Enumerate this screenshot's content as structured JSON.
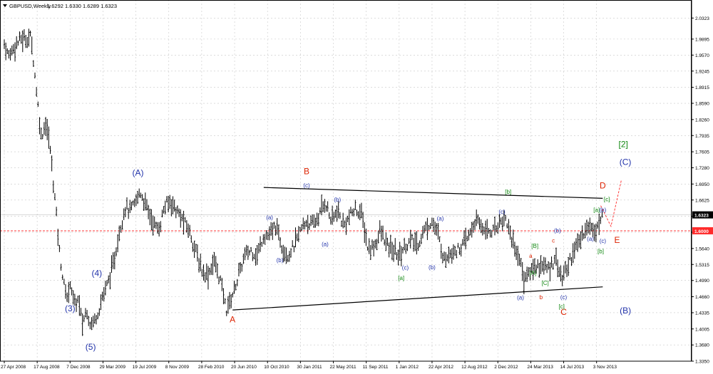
{
  "header": {
    "symbol": "GBPUSD,Weekly",
    "quote": "1.6292 1.6330 1.6289 1.6323"
  },
  "colors": {
    "background": "#ffffff",
    "grid": "#c8c8c8",
    "bars": "#000000",
    "wave_blue": "#2233aa",
    "wave_red": "#dd2200",
    "wave_green": "#118811",
    "level_line": "#ff3b3b",
    "price_label_current": "#000000",
    "price_label_level": "#ff2b2b"
  },
  "chart_data": {
    "type": "ohlc",
    "title": "GBPUSD,Weekly",
    "ylim": [
      1.335,
      2.04
    ],
    "price_ticks": [
      "2.0323",
      "1.9895",
      "1.9570",
      "1.9245",
      "1.8915",
      "1.8590",
      "1.8260",
      "1.7935",
      "1.7605",
      "1.7280",
      "1.6950",
      "1.6625",
      "1.6295",
      "1.5970",
      "1.5640",
      "1.5315",
      "1.4990",
      "1.4660",
      "1.4335",
      "1.4005",
      "1.3680",
      "1.3350"
    ],
    "x_ticks": [
      "27 Apr 2008",
      "17 Aug 2008",
      "7 Dec 2008",
      "29 Mar 2009",
      "19 Jul 2009",
      "8 Nov 2009",
      "28 Feb 2010",
      "20 Jun 2010",
      "10 Oct 2010",
      "30 Jan 2011",
      "22 May 2011",
      "11 Sep 2011",
      "1 Jan 2012",
      "22 Apr 2012",
      "12 Aug 2012",
      "2 Dec 2012",
      "24 Mar 2013",
      "14 Jul 2013",
      "3 Nov 2013"
    ],
    "current_price": {
      "label": "1.6323",
      "value": 1.6323
    },
    "level_line": {
      "label": "1.6000",
      "value": 1.6
    },
    "price_path": [
      [
        "27 Apr 2008",
        1.98
      ],
      [
        "11 May 2008",
        1.955
      ],
      [
        "1 Jun 2008",
        1.975
      ],
      [
        "22 Jun 2008",
        1.99
      ],
      [
        "13 Jul 2008",
        1.99
      ],
      [
        "27 Jul 2008",
        1.995
      ],
      [
        "3 Aug 2008",
        1.955
      ],
      [
        "17 Aug 2008",
        1.87
      ],
      [
        "31 Aug 2008",
        1.79
      ],
      [
        "14 Sep 2008",
        1.82
      ],
      [
        "28 Sep 2008",
        1.78
      ],
      [
        "19 Oct 2008",
        1.65
      ],
      [
        "2 Nov 2008",
        1.55
      ],
      [
        "16 Nov 2008",
        1.49
      ],
      [
        "30 Nov 2008",
        1.46
      ],
      [
        "7 Dec 2008",
        1.5
      ],
      [
        "21 Dec 2008",
        1.45
      ],
      [
        "4 Jan 2009",
        1.46
      ],
      [
        "18 Jan 2009",
        1.41
      ],
      [
        "1 Feb 2009",
        1.44
      ],
      [
        "15 Feb 2009",
        1.41
      ],
      [
        "1 Mar 2009",
        1.42
      ],
      [
        "15 Mar 2009",
        1.44
      ],
      [
        "29 Mar 2009",
        1.47
      ],
      [
        "12 Apr 2009",
        1.49
      ],
      [
        "3 May 2009",
        1.53
      ],
      [
        "24 May 2009",
        1.6
      ],
      [
        "14 Jun 2009",
        1.65
      ],
      [
        "28 Jun 2009",
        1.64
      ],
      [
        "12 Jul 2009",
        1.65
      ],
      [
        "2 Aug 2009",
        1.68
      ],
      [
        "23 Aug 2009",
        1.65
      ],
      [
        "13 Sep 2009",
        1.62
      ],
      [
        "4 Oct 2009",
        1.6
      ],
      [
        "25 Oct 2009",
        1.65
      ],
      [
        "15 Nov 2009",
        1.66
      ],
      [
        "6 Dec 2009",
        1.64
      ],
      [
        "27 Dec 2009",
        1.62
      ],
      [
        "17 Jan 2010",
        1.6
      ],
      [
        "7 Feb 2010",
        1.56
      ],
      [
        "28 Feb 2010",
        1.52
      ],
      [
        "21 Mar 2010",
        1.51
      ],
      [
        "11 Apr 2010",
        1.54
      ],
      [
        "2 May 2010",
        1.5
      ],
      [
        "23 May 2010",
        1.44
      ],
      [
        "13 Jun 2010",
        1.47
      ],
      [
        "4 Jul 2010",
        1.51
      ],
      [
        "25 Jul 2010",
        1.55
      ],
      [
        "15 Aug 2010",
        1.56
      ],
      [
        "5 Sep 2010",
        1.55
      ],
      [
        "26 Sep 2010",
        1.59
      ],
      [
        "17 Oct 2010",
        1.59
      ],
      [
        "7 Nov 2010",
        1.61
      ],
      [
        "28 Nov 2010",
        1.57
      ],
      [
        "19 Dec 2010",
        1.55
      ],
      [
        "9 Jan 2011",
        1.57
      ],
      [
        "30 Jan 2011",
        1.6
      ],
      [
        "20 Feb 2011",
        1.62
      ],
      [
        "13 Mar 2011",
        1.61
      ],
      [
        "3 Apr 2011",
        1.63
      ],
      [
        "24 Apr 2011",
        1.66
      ],
      [
        "15 May 2011",
        1.62
      ],
      [
        "5 Jun 2011",
        1.64
      ],
      [
        "26 Jun 2011",
        1.61
      ],
      [
        "17 Jul 2011",
        1.63
      ],
      [
        "7 Aug 2011",
        1.645
      ],
      [
        "28 Aug 2011",
        1.63
      ],
      [
        "18 Sep 2011",
        1.56
      ],
      [
        "9 Oct 2011",
        1.57
      ],
      [
        "30 Oct 2011",
        1.6
      ],
      [
        "20 Nov 2011",
        1.57
      ],
      [
        "11 Dec 2011",
        1.56
      ],
      [
        "1 Jan 2012",
        1.55
      ],
      [
        "22 Jan 2012",
        1.57
      ],
      [
        "12 Feb 2012",
        1.58
      ],
      [
        "4 Mar 2012",
        1.57
      ],
      [
        "25 Mar 2012",
        1.6
      ],
      [
        "22 Apr 2012",
        1.62
      ],
      [
        "13 May 2012",
        1.59
      ],
      [
        "3 Jun 2012",
        1.54
      ],
      [
        "24 Jun 2012",
        1.56
      ],
      [
        "15 Jul 2012",
        1.56
      ],
      [
        "5 Aug 2012",
        1.57
      ],
      [
        "26 Aug 2012",
        1.59
      ],
      [
        "16 Sep 2012",
        1.62
      ],
      [
        "7 Oct 2012",
        1.61
      ],
      [
        "28 Oct 2012",
        1.6
      ],
      [
        "18 Nov 2012",
        1.6
      ],
      [
        "9 Dec 2012",
        1.62
      ],
      [
        "30 Dec 2012",
        1.625
      ],
      [
        "20 Jan 2013",
        1.58
      ],
      [
        "10 Feb 2013",
        1.55
      ],
      [
        "3 Mar 2013",
        1.5
      ],
      [
        "24 Mar 2013",
        1.52
      ],
      [
        "14 Apr 2013",
        1.53
      ],
      [
        "5 May 2013",
        1.53
      ],
      [
        "26 May 2013",
        1.52
      ],
      [
        "16 Jun 2013",
        1.55
      ],
      [
        "7 Jul 2013",
        1.5
      ],
      [
        "28 Jul 2013",
        1.53
      ],
      [
        "18 Aug 2013",
        1.56
      ],
      [
        "8 Sep 2013",
        1.58
      ],
      [
        "29 Sep 2013",
        1.61
      ],
      [
        "20 Oct 2013",
        1.605
      ],
      [
        "10 Nov 2013",
        1.61
      ],
      [
        "24 Nov 2013",
        1.632
      ]
    ],
    "trend_lines": [
      {
        "name": "upper",
        "from": [
          "27 Sep 2010",
          1.688
        ],
        "to": [
          "24 Nov 2013",
          1.666
        ]
      },
      {
        "name": "lower",
        "from": [
          "13 Jun 2010",
          1.439
        ],
        "to": [
          "24 Nov 2013",
          1.486
        ]
      }
    ],
    "projection": {
      "points": [
        [
          "17 Nov 2013",
          1.651
        ],
        [
          "22 Dec 2013",
          1.609
        ],
        [
          "26 Jan 2014",
          1.702
        ]
      ]
    },
    "wave_labels": [
      {
        "text": "(A)",
        "color": "blue",
        "size": "large",
        "at": [
          "26 Jul 2009",
          1.712
        ]
      },
      {
        "text": "(4)",
        "color": "blue",
        "size": "large",
        "at": [
          "8 Mar 2009",
          1.508
        ]
      },
      {
        "text": "(3)",
        "color": "blue",
        "size": "large",
        "at": [
          "7 Dec 2008",
          1.436
        ]
      },
      {
        "text": "(5)",
        "color": "blue",
        "size": "large",
        "at": [
          "15 Feb 2009",
          1.358
        ]
      },
      {
        "text": "A",
        "color": "red",
        "size": "large",
        "at": [
          "13 Jun 2010",
          1.414
        ]
      },
      {
        "text": "B",
        "color": "red",
        "size": "large",
        "at": [
          "20 Feb 2011",
          1.715
        ]
      },
      {
        "text": "C",
        "color": "red",
        "size": "large",
        "at": [
          "14 Jul 2013",
          1.429
        ]
      },
      {
        "text": "D",
        "color": "red",
        "size": "large",
        "at": [
          "24 Nov 2013",
          1.686
        ]
      },
      {
        "text": "E",
        "color": "red",
        "size": "large",
        "at": [
          "12 Jan 2014",
          1.575
        ]
      },
      {
        "text": "(C)",
        "color": "blue",
        "size": "large",
        "at": [
          "9 Feb 2014",
          1.734
        ]
      },
      {
        "text": "(B)",
        "color": "blue",
        "size": "large",
        "at": [
          "9 Feb 2014",
          1.432
        ]
      },
      {
        "text": "[2]",
        "color": "green",
        "size": "large",
        "at": [
          "2 Feb 2014",
          1.77
        ]
      },
      {
        "text": "(a)",
        "color": "blue",
        "size": "small",
        "at": [
          "17 Oct 2010",
          1.623
        ]
      },
      {
        "text": "(b)",
        "color": "blue",
        "size": "small",
        "at": [
          "21 Nov 2010",
          1.536
        ]
      },
      {
        "text": "(c)",
        "color": "blue",
        "size": "small",
        "at": [
          "20 Feb 2011",
          1.688
        ]
      },
      {
        "text": "(b)",
        "color": "blue",
        "size": "small",
        "at": [
          "5 Jun 2011",
          1.659
        ]
      },
      {
        "text": "(a)",
        "color": "blue",
        "size": "small",
        "at": [
          "24 Apr 2011",
          1.569
        ]
      },
      {
        "text": "(c)",
        "color": "blue",
        "size": "small",
        "at": [
          "22 Jan 2012",
          1.521
        ]
      },
      {
        "text": "[a]",
        "color": "green",
        "size": "small",
        "at": [
          "8 Jan 2012",
          1.5
        ]
      },
      {
        "text": "(a)",
        "color": "blue",
        "size": "small",
        "at": [
          "20 May 2012",
          1.621
        ]
      },
      {
        "text": "(b)",
        "color": "blue",
        "size": "small",
        "at": [
          "22 Apr 2012",
          1.522
        ]
      },
      {
        "text": "(c)",
        "color": "blue",
        "size": "small",
        "at": [
          "16 Dec 2012",
          1.635
        ]
      },
      {
        "text": "[b]",
        "color": "green",
        "size": "small",
        "at": [
          "6 Jan 2013",
          1.675
        ]
      },
      {
        "text": "(a)",
        "color": "blue",
        "size": "small",
        "at": [
          "17 Feb 2013",
          1.46
        ]
      },
      {
        "text": "b",
        "color": "red",
        "size": "small",
        "at": [
          "28 Apr 2013",
          1.461
        ]
      },
      {
        "text": "(c)",
        "color": "blue",
        "size": "small",
        "at": [
          "14 Jul 2013",
          1.461
        ]
      },
      {
        "text": "[c]",
        "color": "green",
        "size": "small",
        "at": [
          "7 Jul 2013",
          1.442
        ]
      },
      {
        "text": "a",
        "color": "red",
        "size": "small",
        "at": [
          "24 Mar 2013",
          1.545
        ]
      },
      {
        "text": "c",
        "color": "red",
        "size": "small",
        "at": [
          "9 Jun 2013",
          1.576
        ]
      },
      {
        "text": "[B]",
        "color": "green",
        "size": "small",
        "at": [
          "7 Apr 2013",
          1.565
        ]
      },
      {
        "text": "[A]",
        "color": "green",
        "size": "small",
        "at": [
          "31 Mar 2013",
          1.51
        ]
      },
      {
        "text": "[C]",
        "color": "green",
        "size": "small",
        "at": [
          "12 May 2013",
          1.49
        ]
      },
      {
        "text": "(b)",
        "color": "blue",
        "size": "small",
        "at": [
          "23 Jun 2013",
          1.596
        ]
      },
      {
        "text": "[a]",
        "color": "green",
        "size": "small",
        "at": [
          "3 Nov 2013",
          1.638
        ]
      },
      {
        "text": "(b)",
        "color": "blue",
        "size": "small",
        "at": [
          "24 Nov 2013",
          1.638
        ]
      },
      {
        "text": "[c]",
        "color": "green",
        "size": "small",
        "at": [
          "8 Dec 2013",
          1.66
        ]
      },
      {
        "text": "(a)",
        "color": "blue",
        "size": "small",
        "at": [
          "13 Oct 2013",
          1.58
        ]
      },
      {
        "text": "(c)",
        "color": "blue",
        "size": "small",
        "at": [
          "24 Nov 2013",
          1.575
        ]
      },
      {
        "text": "[b]",
        "color": "green",
        "size": "small",
        "at": [
          "17 Nov 2013",
          1.554
        ]
      }
    ]
  }
}
